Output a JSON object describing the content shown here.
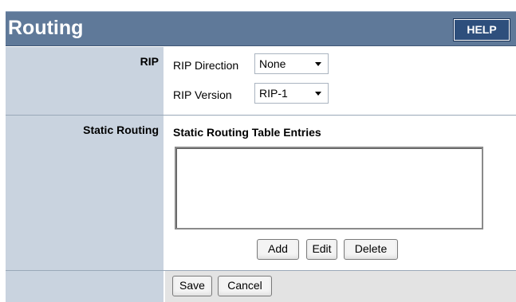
{
  "header": {
    "title": "Routing",
    "help_label": "HELP"
  },
  "rip": {
    "section_label": "RIP",
    "direction_label": "RIP Direction",
    "direction_value": "None",
    "version_label": "RIP Version",
    "version_value": "RIP-1"
  },
  "static_routing": {
    "section_label": "Static Routing",
    "table_title": "Static Routing Table Entries",
    "entries": [],
    "add_label": "Add",
    "edit_label": "Edit",
    "delete_label": "Delete"
  },
  "footer": {
    "save_label": "Save",
    "cancel_label": "Cancel"
  },
  "colors": {
    "header_bg": "#5f7999",
    "help_bg": "#2e4f7c",
    "label_column_bg": "#c9d3df",
    "footer_bg": "#e3e3e3"
  }
}
